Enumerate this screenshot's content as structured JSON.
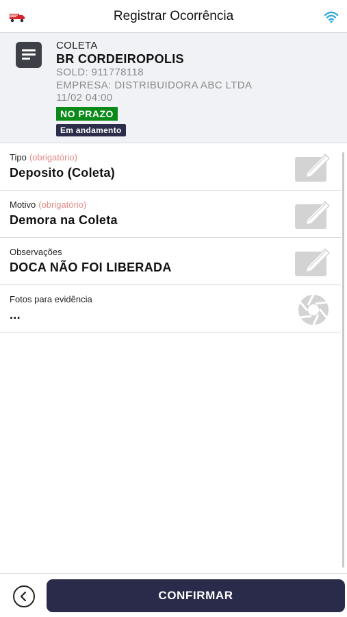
{
  "topbar": {
    "title": "Registrar Ocorrência",
    "logo_icon": "truck-logo-icon",
    "status_icon": "wifi-icon",
    "accent_color": "#2aa6d8"
  },
  "shipment": {
    "type": "COLETA",
    "name": "BR CORDEIROPOLIS",
    "sold": "SOLD: 911778118",
    "company": "EMPRESA: DISTRIBUIDORA ABC LTDA",
    "datetime": "11/02 04:00",
    "deadline_badge": "NO PRAZO",
    "status_badge": "Em andamento",
    "icon": "document-icon"
  },
  "form": {
    "fields": [
      {
        "label": "Tipo",
        "required": "(obrigatório)",
        "value": "Deposito (Coleta)",
        "action_icon": "edit-icon"
      },
      {
        "label": "Motivo",
        "required": "(obrigatório)",
        "value": "Demora na Coleta",
        "action_icon": "edit-icon"
      },
      {
        "label": "Observações",
        "value": "DOCA NÃO FOI LIBERADA",
        "action_icon": "edit-icon"
      },
      {
        "label": "Fotos para evidência",
        "value": "...",
        "action_icon": "camera-shutter-icon"
      }
    ]
  },
  "footer": {
    "back_icon": "chevron-left-icon",
    "confirm_label": "CONFIRMAR"
  },
  "colors": {
    "primary_dark": "#2a2b4a",
    "on_time_green": "#0a8a18",
    "required_text": "#e58a86",
    "header_bg": "#f1f2f6"
  }
}
